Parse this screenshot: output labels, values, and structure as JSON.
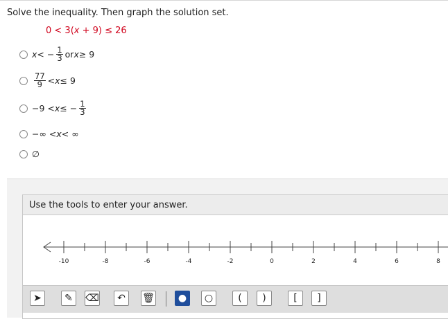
{
  "question": {
    "prompt": "Solve the inequality. Then graph the solution set.",
    "inequality": {
      "lhs": "0 < 3(",
      "var": "x",
      "rhs": " + 9) ≤ 26"
    }
  },
  "choices": [
    {
      "pre_var": "x",
      "pre_text": " < −",
      "frac": {
        "num": "1",
        "den": "3"
      },
      "post_text": " or ",
      "post_var": "x",
      "post_tail": " ≥ 9"
    },
    {
      "frac": {
        "num": "77",
        "den": "9"
      },
      "text": " < ",
      "var": "x",
      "tail": " ≤ 9"
    },
    {
      "pre_text": "−9 < ",
      "var": "x",
      "mid_text": " ≤ −",
      "frac": {
        "num": "1",
        "den": "3"
      }
    },
    {
      "pre_text": "−∞ < ",
      "var": "x",
      "tail": " < ∞"
    },
    {
      "text": "∅"
    }
  ],
  "graph_panel": {
    "instruction": "Use the tools to enter your answer.",
    "number_line": {
      "min_label": -10,
      "labels": [
        "-10",
        "-8",
        "-6",
        "-4",
        "-2",
        "0",
        "2",
        "4",
        "6",
        "8"
      ],
      "arrow_left": true,
      "arrow_right": true
    }
  },
  "toolbar": {
    "tools": [
      {
        "name": "select-tool",
        "icon": "arrow-cursor-icon",
        "symbol": "➤",
        "active": false
      },
      {
        "name": "pencil-tool",
        "icon": "pencil-icon",
        "symbol": "✎",
        "active": false
      },
      {
        "name": "eraser-tool",
        "icon": "eraser-icon",
        "symbol": "⌫",
        "active": false
      },
      {
        "name": "undo-tool",
        "icon": "undo-icon",
        "symbol": "↶",
        "active": false
      },
      {
        "name": "delete-tool",
        "icon": "trash-icon",
        "symbol": "🗑",
        "active": false
      },
      {
        "name": "closed-point-tool",
        "icon": "filled-circle-icon",
        "symbol": "●",
        "active": true
      },
      {
        "name": "open-point-tool",
        "icon": "open-circle-icon",
        "symbol": "○",
        "active": false
      },
      {
        "name": "open-interval-left",
        "icon": "left-paren-icon",
        "symbol": "(",
        "active": false
      },
      {
        "name": "open-interval-right",
        "icon": "right-paren-icon",
        "symbol": ")",
        "active": false
      },
      {
        "name": "closed-interval-left",
        "icon": "left-bracket-icon",
        "symbol": "[",
        "active": false
      },
      {
        "name": "closed-interval-right",
        "icon": "right-bracket-icon",
        "symbol": "]",
        "active": false
      }
    ]
  },
  "colors": {
    "inequality_red": "#d0021b",
    "active_tool_blue": "#1f4e9c"
  }
}
